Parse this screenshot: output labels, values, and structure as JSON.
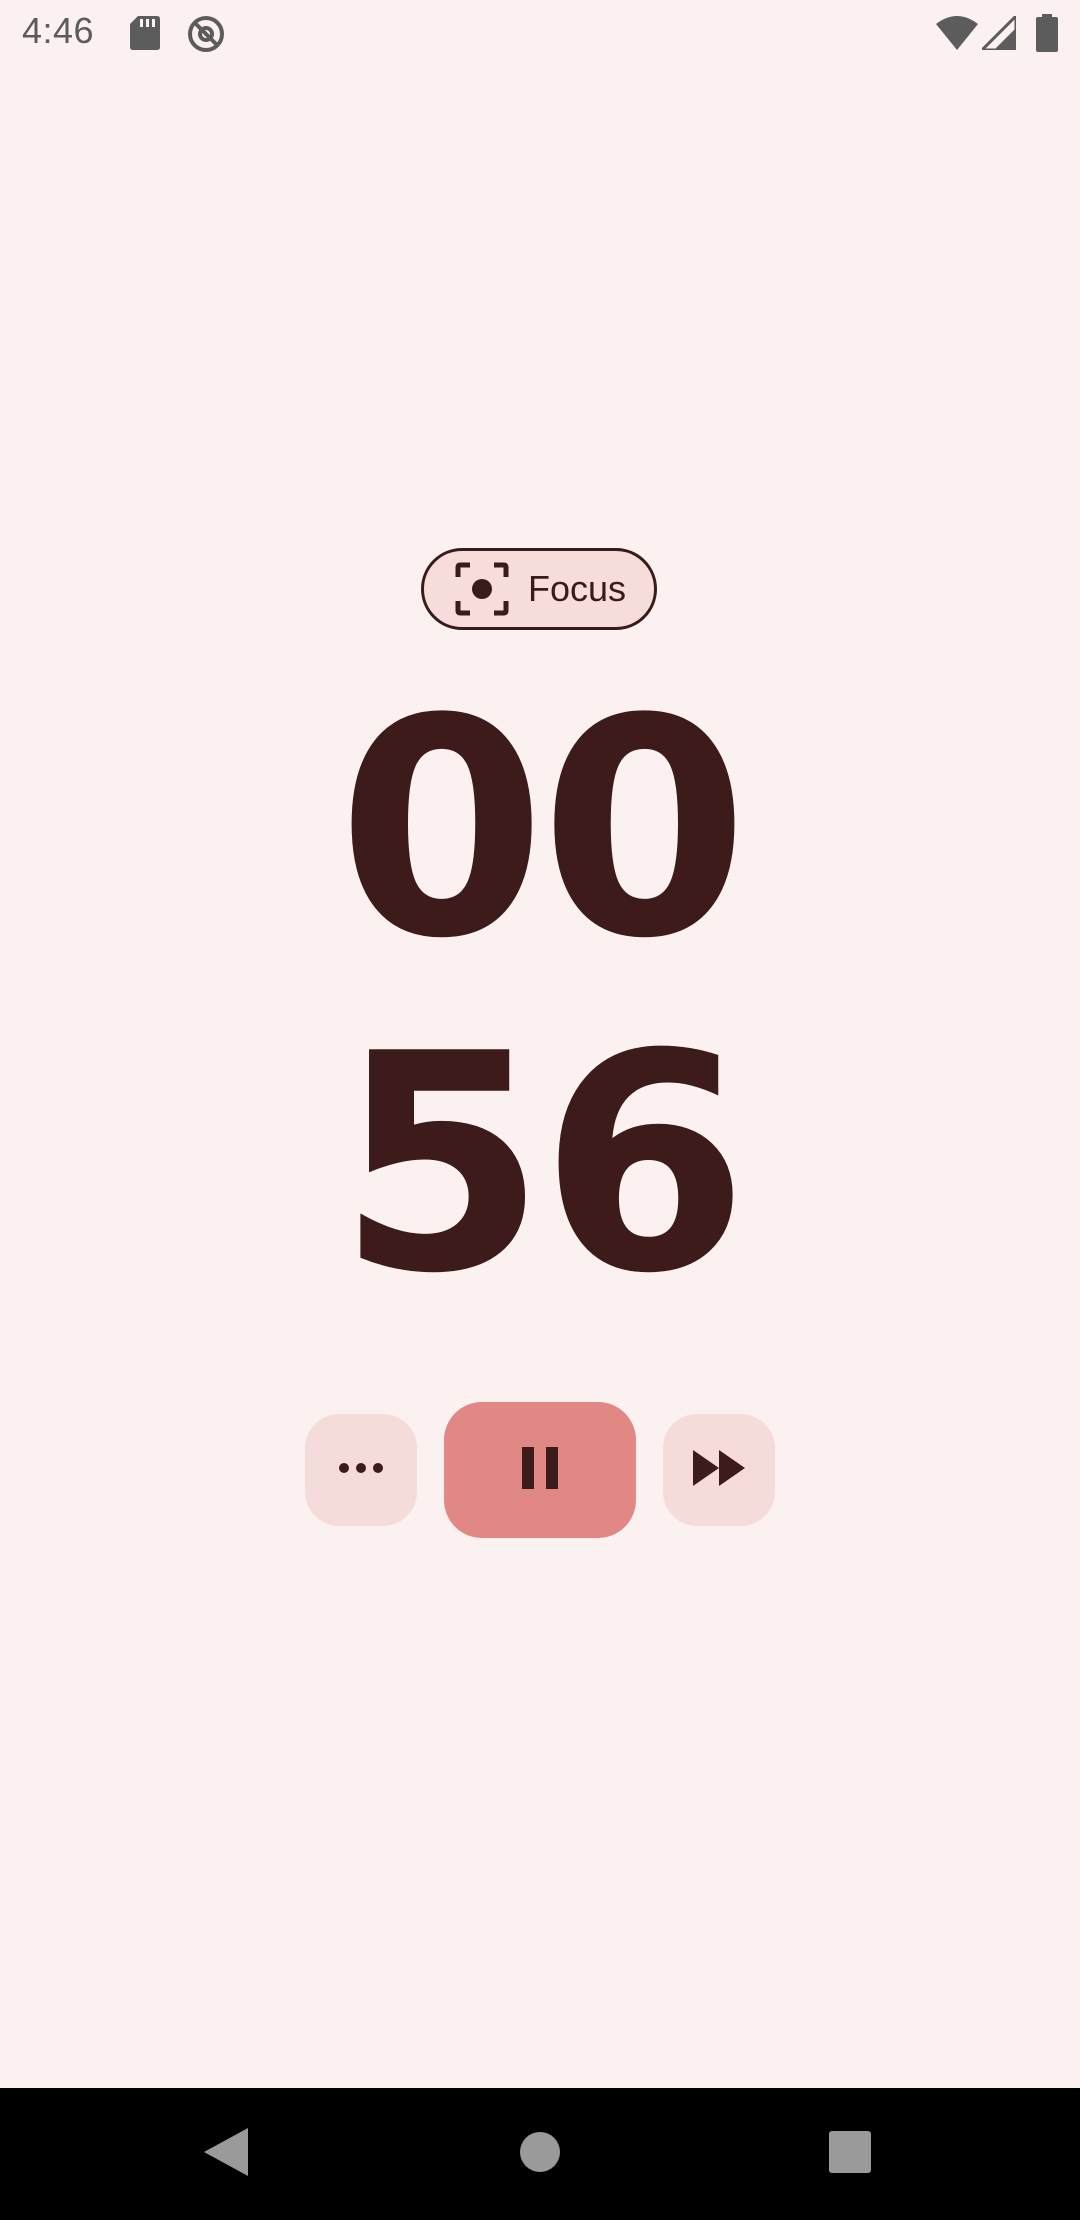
{
  "status_bar": {
    "time": "4:46",
    "left_icons": [
      "sd-card-icon",
      "at-sign-icon"
    ],
    "right_icons": [
      "wifi-icon",
      "cell-signal-icon",
      "battery-icon"
    ]
  },
  "focus_chip": {
    "label": "Focus",
    "icon": "center-focus-icon"
  },
  "timer": {
    "minutes": "00",
    "seconds": "56"
  },
  "controls": {
    "more_icon": "more-horizontal-icon",
    "pause_icon": "pause-icon",
    "skip_icon": "fast-forward-icon"
  },
  "nav_bar": {
    "buttons": [
      "back-icon",
      "home-icon",
      "recents-icon"
    ]
  },
  "colors": {
    "background": "#fcf1f1",
    "text": "#3d1b1b",
    "chip_bg": "#f6dcda",
    "primary_button": "#e18784",
    "secondary_button": "#f5dcdb"
  }
}
